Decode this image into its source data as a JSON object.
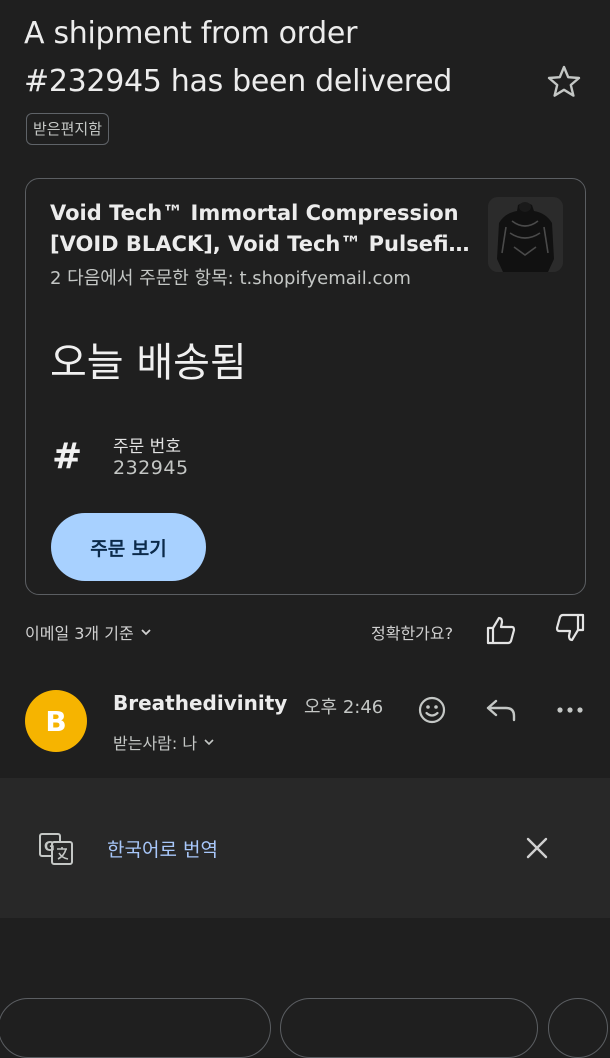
{
  "email": {
    "subject_line1": "A shipment from order",
    "subject_line2": "#232945 has been delivered",
    "label": "받은편지함"
  },
  "card": {
    "item_title_line1": "Void Tech™ Immortal Compression",
    "item_title_line2": "[VOID BLACK], Void Tech™ Pulsefi...",
    "item_meta": "2 다음에서 주문한 항목: t.shopifyemail.com",
    "status": "오늘 배송됨",
    "order_label": "주문 번호",
    "order_number": "232945",
    "view_button": "주문 보기"
  },
  "summary": {
    "based_on": "이메일 3개 기준",
    "accurate_question": "정확한가요?"
  },
  "sender": {
    "avatar_letter": "B",
    "name": "Breathedivinity",
    "time": "오후 2:46",
    "recipient": "받는사람: 나"
  },
  "translate": {
    "label": "한국어로 번역"
  },
  "bottom": {
    "left_text": "",
    "right_text": ""
  },
  "colors": {
    "background": "#1f1f1f",
    "button_bg": "#a8d1ff",
    "avatar": "#f6b400",
    "link": "#a8c7fa"
  }
}
